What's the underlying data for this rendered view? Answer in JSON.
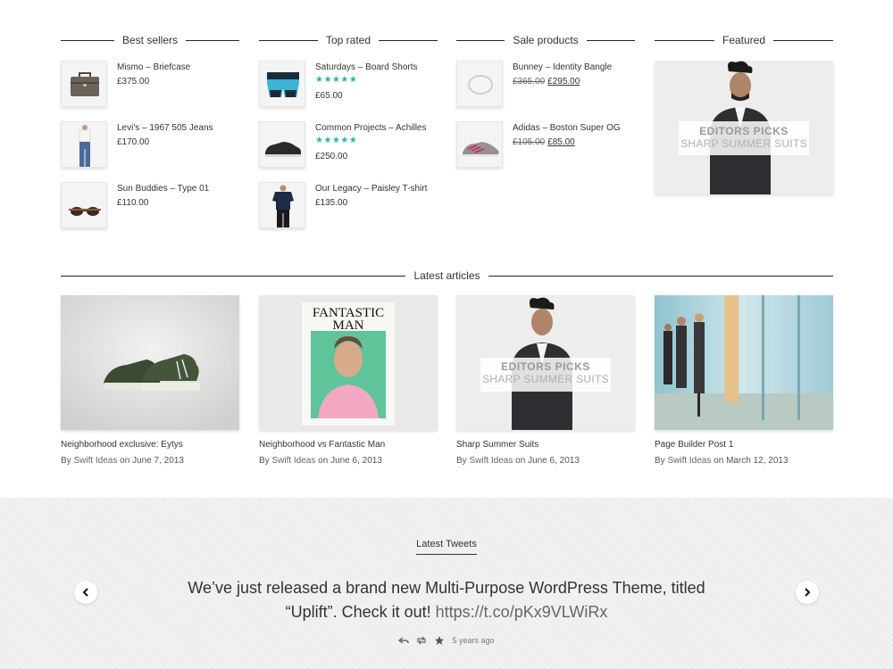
{
  "widgets": {
    "best_sellers": {
      "title": "Best sellers",
      "items": [
        {
          "name": "Mismo – Briefcase",
          "price": "£375.00"
        },
        {
          "name": "Levi's – 1967 505 Jeans",
          "price": "£170.00"
        },
        {
          "name": "Sun Buddies – Type 01",
          "price": "£110.00"
        }
      ]
    },
    "top_rated": {
      "title": "Top rated",
      "items": [
        {
          "name": "Saturdays – Board Shorts",
          "stars": "★★★★★",
          "price": "£65.00"
        },
        {
          "name": "Common Projects – Achilles",
          "stars": "★★★★★",
          "price": "£250.00"
        },
        {
          "name": "Our Legacy – Paisley T-shirt",
          "price": "£135.00"
        }
      ]
    },
    "sale_products": {
      "title": "Sale products",
      "items": [
        {
          "name": "Bunney – Identity Bangle",
          "old_price": "£365.00",
          "new_price": "£295.00"
        },
        {
          "name": "Adidas – Boston Super OG",
          "old_price": "£105.00",
          "new_price": "£85.00"
        }
      ]
    },
    "featured": {
      "title": "Featured",
      "banner_line1": "EDITORS PICKS",
      "banner_line2": "SHARP SUMMER SUITS"
    }
  },
  "articles": {
    "heading": "Latest articles",
    "by": "By",
    "on": "on",
    "items": [
      {
        "title": "Neighborhood exclusive: Eytys",
        "author": "Swift Ideas",
        "date": "June 7, 2013"
      },
      {
        "title": "Neighborhood vs Fantastic Man",
        "author": "Swift Ideas",
        "date": "June 6, 2013",
        "cover_title1": "FANTASTIC",
        "cover_title2": "MAN"
      },
      {
        "title": "Sharp Summer Suits",
        "author": "Swift Ideas",
        "date": "June 6, 2013",
        "banner_line1": "EDITORS PICKS",
        "banner_line2": "SHARP SUMMER SUITS"
      },
      {
        "title": "Page Builder Post 1",
        "author": "Swift Ideas",
        "date": "March 12, 2013"
      }
    ]
  },
  "tweets": {
    "heading": "Latest Tweets",
    "text": "We’ve just released a brand new Multi-Purpose WordPress Theme, titled “Uplift”. Check it out!",
    "link": "https://t.co/pKx9VLWiRx",
    "time": "5 years ago"
  },
  "colors": {
    "star": "#2bb5a5",
    "line": "#222222",
    "tweets_bg": "#f2f2f2"
  }
}
